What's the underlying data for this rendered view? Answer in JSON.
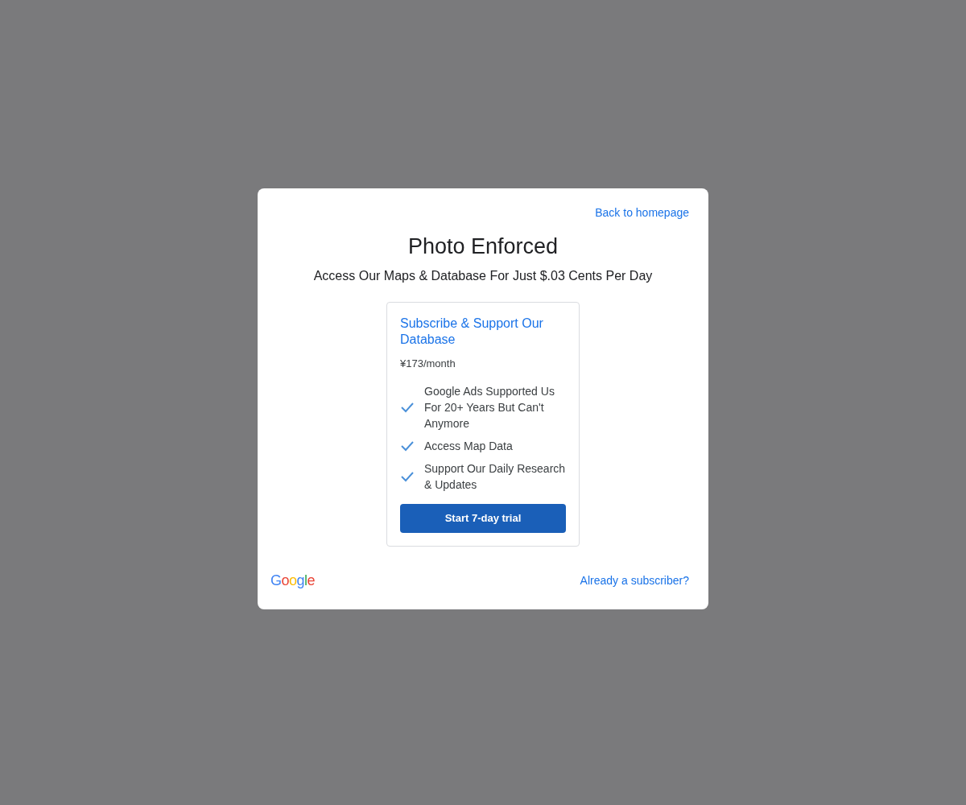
{
  "dialog": {
    "back_link": "Back to homepage",
    "title": "Photo Enforced",
    "subtitle": "Access Our Maps & Database For Just $.03 Cents Per Day",
    "offer": {
      "title": "Subscribe & Support Our Database",
      "price": "¥173/month",
      "features": [
        "Google Ads Supported Us For 20+ Years But Can't Anymore",
        "Access Map Data",
        "Support Our Daily Research & Updates"
      ],
      "button": "Start 7-day trial"
    },
    "footer": {
      "logo": "Google",
      "link": "Already a subscriber?"
    }
  }
}
